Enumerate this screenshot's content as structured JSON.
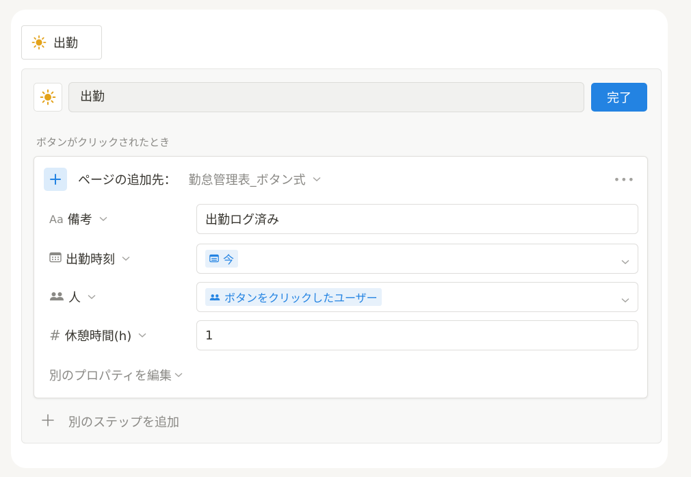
{
  "button_preview": {
    "icon": "sun-icon",
    "label": "出勤"
  },
  "editor": {
    "icon": "sun-icon",
    "name_value": "出勤",
    "done_label": "完了",
    "when_label": "ボタンがクリックされたとき",
    "step": {
      "title": "ページの追加先：",
      "target": "勤怠管理表_ボタン式",
      "more_label": "•••",
      "properties": [
        {
          "icon": "text-icon",
          "icon_text": "Aa",
          "label": "備考",
          "value": "出勤ログ済み"
        },
        {
          "icon": "calendar-icon",
          "label": "出勤時刻",
          "value": "今",
          "value_type": "date-chip"
        },
        {
          "icon": "people-icon",
          "label": "人",
          "value": "ボタンをクリックしたユーザー",
          "value_type": "person-chip"
        },
        {
          "icon": "number-icon",
          "icon_text": "#",
          "label": "休憩時間(h)",
          "value": "1"
        }
      ],
      "edit_other_label": "別のプロパティを編集"
    },
    "add_step_label": "別のステップを追加"
  },
  "colors": {
    "accent": "#2383e2",
    "sun": "#e3a21a"
  }
}
